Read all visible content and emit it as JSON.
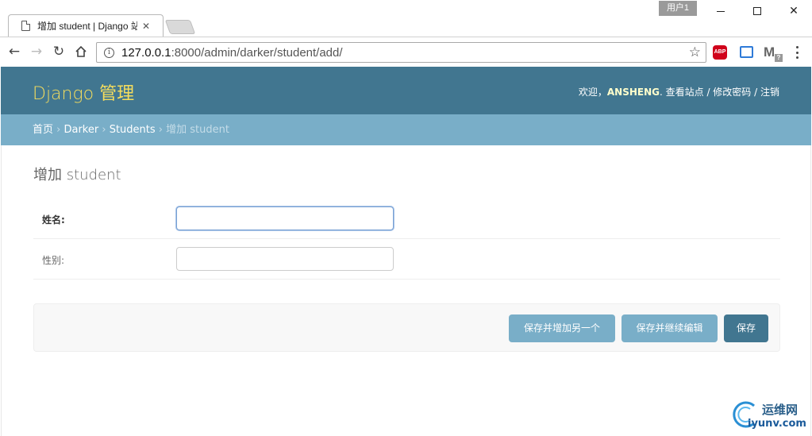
{
  "browser": {
    "tab_title": "增加 student | Django 站",
    "tab_close": "✕",
    "user_profile": "用户1",
    "url_host": "127.0.0.1",
    "url_path": ":8000/admin/darker/student/add/",
    "ext_abp_label": "ABP",
    "ext_gmail_label": "M",
    "ext_gmail_badge": "?",
    "icons": {
      "back": "arrow-left-icon",
      "forward": "arrow-right-icon",
      "reload": "reload-icon",
      "home": "home-icon",
      "info": "info-icon",
      "star": "star-icon",
      "menu": "more-vertical-icon"
    }
  },
  "header": {
    "branding": "Django 管理",
    "welcome": "欢迎，",
    "username": "ANSHENG",
    "view_site": "查看站点",
    "change_password": "修改密码",
    "logout": "注销",
    "separator": " / "
  },
  "breadcrumbs": {
    "home": "首页",
    "app": "Darker",
    "model": "Students",
    "current": "增加 student",
    "separator": " › "
  },
  "form": {
    "title": "增加 student",
    "fields": [
      {
        "label": "姓名:",
        "value": "",
        "required": true
      },
      {
        "label": "性别:",
        "value": "",
        "required": false
      }
    ],
    "buttons": {
      "save_add_another": "保存并增加另一个",
      "save_continue": "保存并继续编辑",
      "save": "保存"
    }
  },
  "watermark": {
    "cn": "运维网",
    "en": "iyunv.com"
  },
  "colors": {
    "header_bg": "#417690",
    "branding": "#f5dd5d",
    "breadcrumbs_bg": "#79aec8",
    "primary_button": "#417690",
    "secondary_button": "#79aec8"
  }
}
